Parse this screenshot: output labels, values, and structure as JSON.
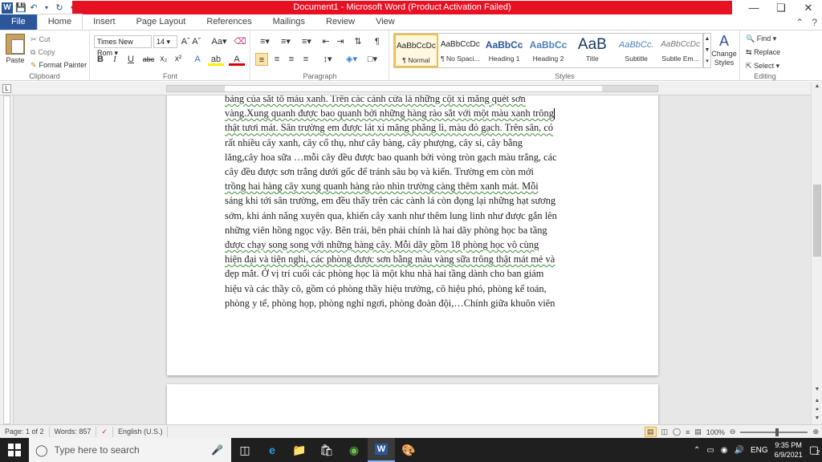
{
  "window": {
    "title": "Document1 - Microsoft Word (Product Activation Failed)"
  },
  "tabs": [
    {
      "label": "File"
    },
    {
      "label": "Home"
    },
    {
      "label": "Insert"
    },
    {
      "label": "Page Layout"
    },
    {
      "label": "References"
    },
    {
      "label": "Mailings"
    },
    {
      "label": "Review"
    },
    {
      "label": "View"
    }
  ],
  "clipboard": {
    "paste": "Paste",
    "cut": "Cut",
    "copy": "Copy",
    "format_painter": "Format Painter",
    "group": "Clipboard"
  },
  "font": {
    "name": "Times New Rom",
    "size": "14",
    "group": "Font"
  },
  "paragraph": {
    "group": "Paragraph"
  },
  "styles": {
    "group": "Styles",
    "items": [
      {
        "sample": "AaBbCcDc",
        "name": "¶ Normal"
      },
      {
        "sample": "AaBbCcDc",
        "name": "¶ No Spaci..."
      },
      {
        "sample": "AaBbCc",
        "name": "Heading 1"
      },
      {
        "sample": "AaBbCc",
        "name": "Heading 2"
      },
      {
        "sample": "AaB",
        "name": "Title"
      },
      {
        "sample": "AaBbCc.",
        "name": "Subtitle"
      },
      {
        "sample": "AaBbCcDc",
        "name": "Subtle Em..."
      }
    ],
    "change_styles": "Change Styles"
  },
  "editing": {
    "find": "Find",
    "replace": "Replace",
    "select": "Select",
    "group": "Editing"
  },
  "document": {
    "lines": [
      "bảng của sắt tô màu xanh. Trên các cánh cửa là những cột xi măng quét sơn",
      "vàng.Xung quanh được bao quanh bởi những hàng rào sắt với một màu xanh trông",
      "thật tươi mát. Sân trường em được lát xi măng phẳng lì, màu đỏ gạch. Trên sân, có",
      "rất nhiều cây xanh, cây cổ thụ, như cây bàng, cây phượng, cây si, cây bằng",
      "lăng,cây hoa sữa …mỗi cây đều được bao quanh bởi vòng tròn gạch màu trắng, các",
      "cây đều được sơn trắng dưới gốc để tránh sâu bọ và kiến. Trường em còn mới",
      "trồng hai hàng cây xung quanh hàng rào nhìn trường càng thêm xanh mát. Mỗi",
      "sáng khi tới sân trường, em đều thấy trên các cành lá còn đọng lại những hạt sương",
      "sớm, khi ánh nắng xuyên qua, khiến cây xanh như thêm lung linh như được gắn lên",
      "những viên hồng ngọc vậy. Bên trái, bên phải chính là hai dãy phòng học ba tầng",
      "được chạy song song với những hàng cây. Mỗi dãy gồm 18 phòng học vô cùng",
      "hiện đại và tiện nghi, các phòng được sơn bằng màu vàng sữa trông thật mát mẻ và",
      "đẹp mắt. Ở vị trí cuối các phòng học là một khu nhà hai tầng dành cho ban giám",
      "hiệu và các thầy cô, gồm có phòng thầy hiệu trưởng, cô hiệu phó, phòng kế toán,",
      "phòng y tế, phòng họp, phòng nghỉ ngơi, phòng đoàn đội,…Chính giữa khuôn viên"
    ]
  },
  "status": {
    "page": "Page: 1 of 2",
    "words": "Words: 857",
    "language": "English (U.S.)",
    "zoom": "100%"
  },
  "taskbar": {
    "search_placeholder": "Type here to search",
    "language": "ENG",
    "time": "9:35 PM",
    "date": "6/9/2021",
    "notifications": "2"
  },
  "colors": {
    "accent": "#2b579a",
    "title_alert": "#e81123"
  }
}
